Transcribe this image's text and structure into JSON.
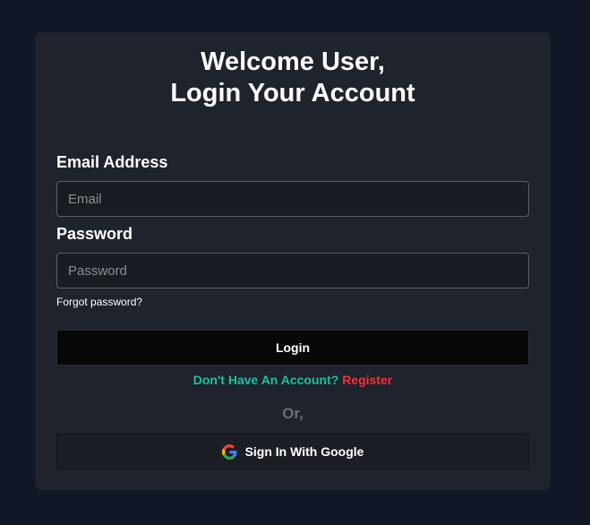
{
  "header": {
    "title_line1": "Welcome User,",
    "title_line2": "Login Your Account"
  },
  "form": {
    "email_label": "Email Address",
    "email_placeholder": "Email",
    "email_value": "",
    "password_label": "Password",
    "password_placeholder": "Password",
    "password_value": "",
    "forgot_label": "Forgot password?",
    "login_label": "Login"
  },
  "register": {
    "prompt": "Don't Have An Account?",
    "link_label": "Register"
  },
  "divider": {
    "or_label": "Or,"
  },
  "google": {
    "label": "Sign In With Google",
    "icon": "google-icon"
  },
  "colors": {
    "page_background": "#101727",
    "card_background": "#1f232b",
    "prompt_accent": "#1fc1a4",
    "register_accent": "#f2323a",
    "login_button": "#070708"
  }
}
